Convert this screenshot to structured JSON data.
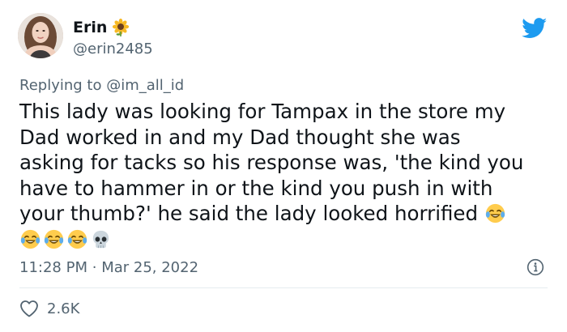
{
  "user": {
    "display_name": "Erin",
    "name_emoji": "sunflower-icon",
    "handle": "@erin2485",
    "avatar": "avatar"
  },
  "reply": {
    "prefix": "Replying to",
    "mention": "@im_all_id"
  },
  "tweet": {
    "lines": [
      "This lady was looking for Tampax in the store my",
      "Dad worked in and my Dad thought she was",
      "asking for tacks so his response was, 'the kind you",
      "have to hammer in or the kind you push in with",
      "your thumb?' he said the lady looked horrified"
    ],
    "trailing_emojis": [
      "crying-laughing-icon",
      "crying-laughing-icon",
      "crying-laughing-icon",
      "crying-laughing-icon",
      "skull-icon"
    ]
  },
  "meta": {
    "time": "11:28 PM",
    "separator": "·",
    "date": "Mar 25, 2022"
  },
  "engagement": {
    "likes": "2.6K"
  },
  "colors": {
    "twitter_blue": "#1d9bf0",
    "secondary_text": "#536471",
    "primary_text": "#0f1419"
  }
}
